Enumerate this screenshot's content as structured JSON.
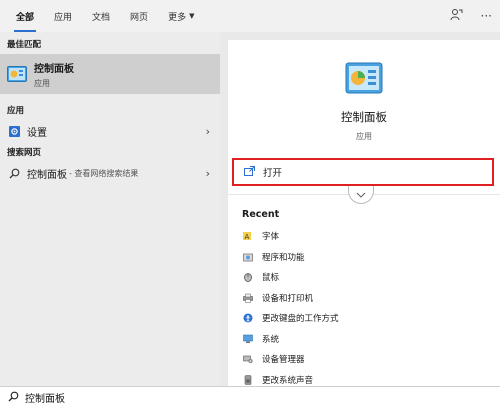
{
  "tabs": [
    {
      "label": "全部",
      "active": true
    },
    {
      "label": "应用"
    },
    {
      "label": "文档"
    },
    {
      "label": "网页"
    },
    {
      "label": "更多"
    }
  ],
  "left": {
    "best_match_title": "最佳匹配",
    "best_match": {
      "name": "控制面板",
      "type": "应用",
      "icon": "control-panel-icon"
    },
    "apps_title": "应用",
    "apps": [
      {
        "label": "设置",
        "icon": "gear-icon"
      }
    ],
    "web_title": "搜索网页",
    "web": [
      {
        "label": "控制面板",
        "hint": "- 查看网络搜索结果",
        "icon": "search-icon"
      }
    ]
  },
  "right": {
    "title": "控制面板",
    "subtitle": "应用",
    "open_label": "打开",
    "recent_title": "Recent",
    "recent": [
      {
        "label": "字体",
        "icon": "font-icon"
      },
      {
        "label": "程序和功能",
        "icon": "programs-icon"
      },
      {
        "label": "鼠标",
        "icon": "mouse-icon"
      },
      {
        "label": "设备和打印机",
        "icon": "printer-icon"
      },
      {
        "label": "更改键盘的工作方式",
        "icon": "keyboard-ease-icon"
      },
      {
        "label": "系统",
        "icon": "system-icon"
      },
      {
        "label": "设备管理器",
        "icon": "device-manager-icon"
      },
      {
        "label": "更改系统声音",
        "icon": "sound-icon"
      }
    ]
  },
  "search": {
    "value": "控制面板"
  },
  "colors": {
    "accent": "#2b6fd1",
    "highlight_border": "#e02020",
    "selected_bg": "#cfcfcf"
  }
}
